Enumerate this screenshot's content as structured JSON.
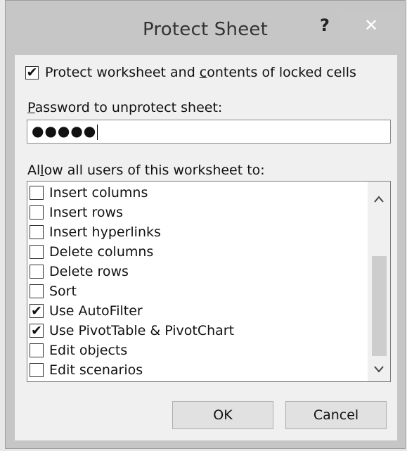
{
  "dialog": {
    "title": "Protect Sheet",
    "help_label": "?",
    "close_label": "✕"
  },
  "protect_contents": {
    "label": "Protect worksheet and contents of locked cells",
    "checked": true
  },
  "password": {
    "label": "Password to unprotect sheet:",
    "value": "●●●●●"
  },
  "allow": {
    "label": "Allow all users of this worksheet to:",
    "items": [
      {
        "label": "Insert columns",
        "checked": false
      },
      {
        "label": "Insert rows",
        "checked": false
      },
      {
        "label": "Insert hyperlinks",
        "checked": false
      },
      {
        "label": "Delete columns",
        "checked": false
      },
      {
        "label": "Delete rows",
        "checked": false
      },
      {
        "label": "Sort",
        "checked": false
      },
      {
        "label": "Use AutoFilter",
        "checked": true
      },
      {
        "label": "Use PivotTable & PivotChart",
        "checked": true
      },
      {
        "label": "Edit objects",
        "checked": false
      },
      {
        "label": "Edit scenarios",
        "checked": false
      }
    ]
  },
  "scrollbar": {
    "up_icon": "^",
    "down_icon": "v"
  },
  "buttons": {
    "ok": "OK",
    "cancel": "Cancel"
  },
  "check_glyph": "✔"
}
